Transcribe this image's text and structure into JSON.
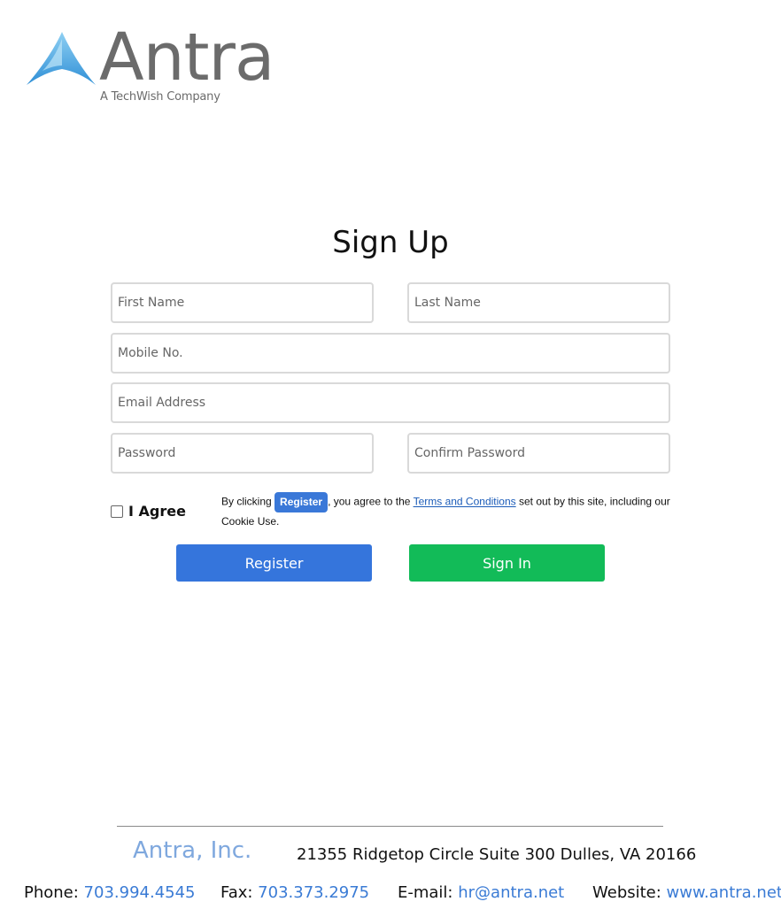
{
  "logo": {
    "wordmark": "Antra",
    "tagline": "A TechWish Company"
  },
  "heading": "Sign Up",
  "form": {
    "first_name_placeholder": "First Name",
    "last_name_placeholder": "Last Name",
    "mobile_placeholder": "Mobile No.",
    "email_placeholder": "Email Address",
    "password_placeholder": "Password",
    "confirm_password_placeholder": "Confirm Password",
    "agree_label": "I Agree",
    "agree_checked": false
  },
  "terms": {
    "prefix": "By clicking ",
    "button_label": "Register",
    "middle": ", you agree to the ",
    "link_text": "Terms and Conditions",
    "suffix": " set out by this site, including our Cookie Use."
  },
  "buttons": {
    "register": "Register",
    "sign_in": "Sign In"
  },
  "footer": {
    "company": "Antra, Inc.",
    "address": "21355 Ridgetop Circle Suite 300 Dulles, VA 20166",
    "phone_label": "Phone: ",
    "phone": "703.994.4545",
    "fax_label": "Fax: ",
    "fax": "703.373.2975",
    "email_label": "E-mail: ",
    "email": "hr@antra.net",
    "website_label": "Website: ",
    "website": "www.antra.net"
  },
  "colors": {
    "register_button": "#3575dc",
    "sign_in_button": "#12bb58",
    "link": "#3a7bd5",
    "company": "#7fa8de",
    "logo_gray": "#6b6b6b",
    "logo_blue": "#4aa8e0"
  }
}
